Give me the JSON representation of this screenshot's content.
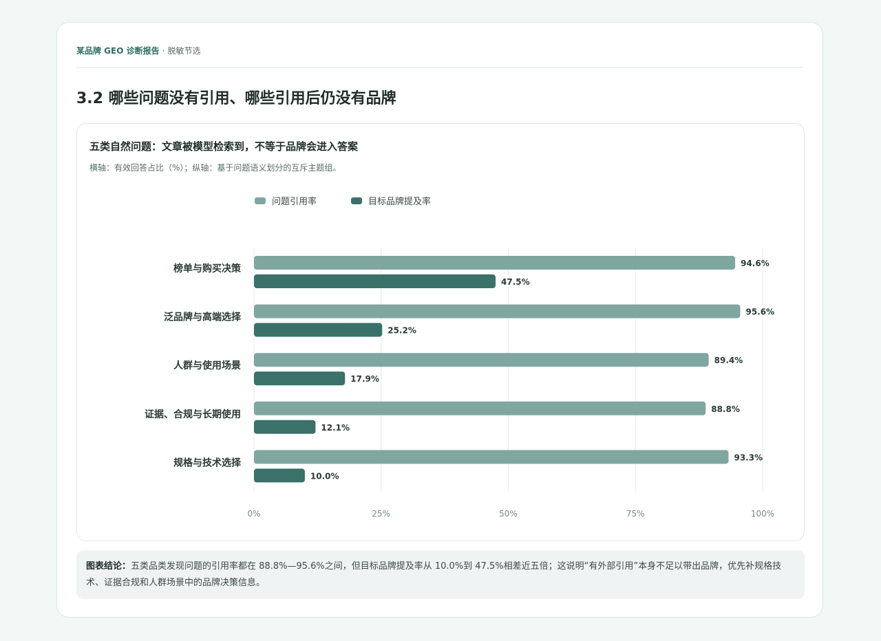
{
  "header": {
    "brand": "某品牌 GEO 诊断报告",
    "separator": "·",
    "note": "脱敏节选"
  },
  "section_title": "3.2 哪些问题没有引用、哪些引用后仍没有品牌",
  "chart": {
    "title": "五类自然问题：文章被模型检索到，不等于品牌会进入答案",
    "subtitle": "横轴：有效回答占比（%）；纵轴：基于问题语义划分的互斥主题组。"
  },
  "chart_data": {
    "type": "bar",
    "orientation": "horizontal",
    "categories": [
      "榜单与购买决策",
      "泛品牌与高端选择",
      "人群与使用场景",
      "证据、合规与长期使用",
      "规格与技术选择"
    ],
    "series": [
      {
        "name": "问题引用率",
        "values": [
          94.6,
          95.6,
          89.4,
          88.8,
          93.3
        ],
        "color": "#80a6a0"
      },
      {
        "name": "目标品牌提及率",
        "values": [
          47.5,
          25.2,
          17.9,
          12.1,
          10.0
        ],
        "color": "#3a7169"
      }
    ],
    "xlim": [
      0,
      100
    ],
    "x_ticks": [
      0,
      25,
      50,
      75,
      100
    ],
    "x_tick_labels": [
      "0%",
      "25%",
      "50%",
      "75%",
      "100%"
    ],
    "value_suffix": "%",
    "grid": "vertical",
    "legend": "top"
  },
  "conclusion": {
    "lead": "图表结论：",
    "text": "五类品类发现问题的引用率都在 88.8%—95.6%之间，但目标品牌提及率从 10.0%到 47.5%相差近五倍；这说明“有外部引用”本身不足以带出品牌，优先补规格技术、证据合规和人群场景中的品牌决策信息。"
  }
}
